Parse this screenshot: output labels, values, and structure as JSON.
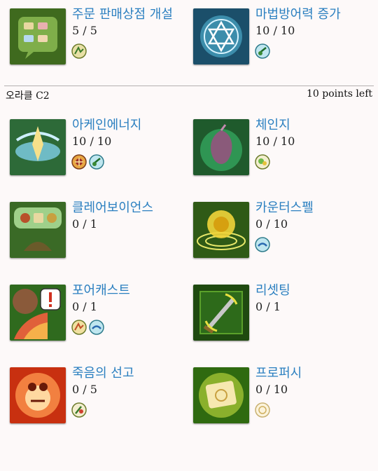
{
  "top_skills": [
    {
      "name": "주문 판매상점 개설",
      "level": "5 / 5",
      "icon": "scroll-shop-icon"
    },
    {
      "name": "마법방어력 증가",
      "level": "10 / 10",
      "icon": "magic-defense-icon"
    }
  ],
  "section": {
    "title": "오라클 C2",
    "points_left": "10 points left"
  },
  "skills": [
    {
      "name": "아케인에너지",
      "level": "10 / 10",
      "icon": "arcane-energy-icon"
    },
    {
      "name": "체인지",
      "level": "10 / 10",
      "icon": "change-icon"
    },
    {
      "name": "클레어보이언스",
      "level": "0 / 1",
      "icon": "clairvoyance-icon"
    },
    {
      "name": "카운터스펠",
      "level": "0 / 10",
      "icon": "counterspell-icon"
    },
    {
      "name": "포어캐스트",
      "level": "0 / 1",
      "icon": "forecast-icon"
    },
    {
      "name": "리셋팅",
      "level": "0 / 1",
      "icon": "resetting-icon"
    },
    {
      "name": "죽음의 선고",
      "level": "0 / 5",
      "icon": "death-sentence-icon"
    },
    {
      "name": "프로퍼시",
      "level": "0 / 10",
      "icon": "prophecy-icon"
    }
  ]
}
